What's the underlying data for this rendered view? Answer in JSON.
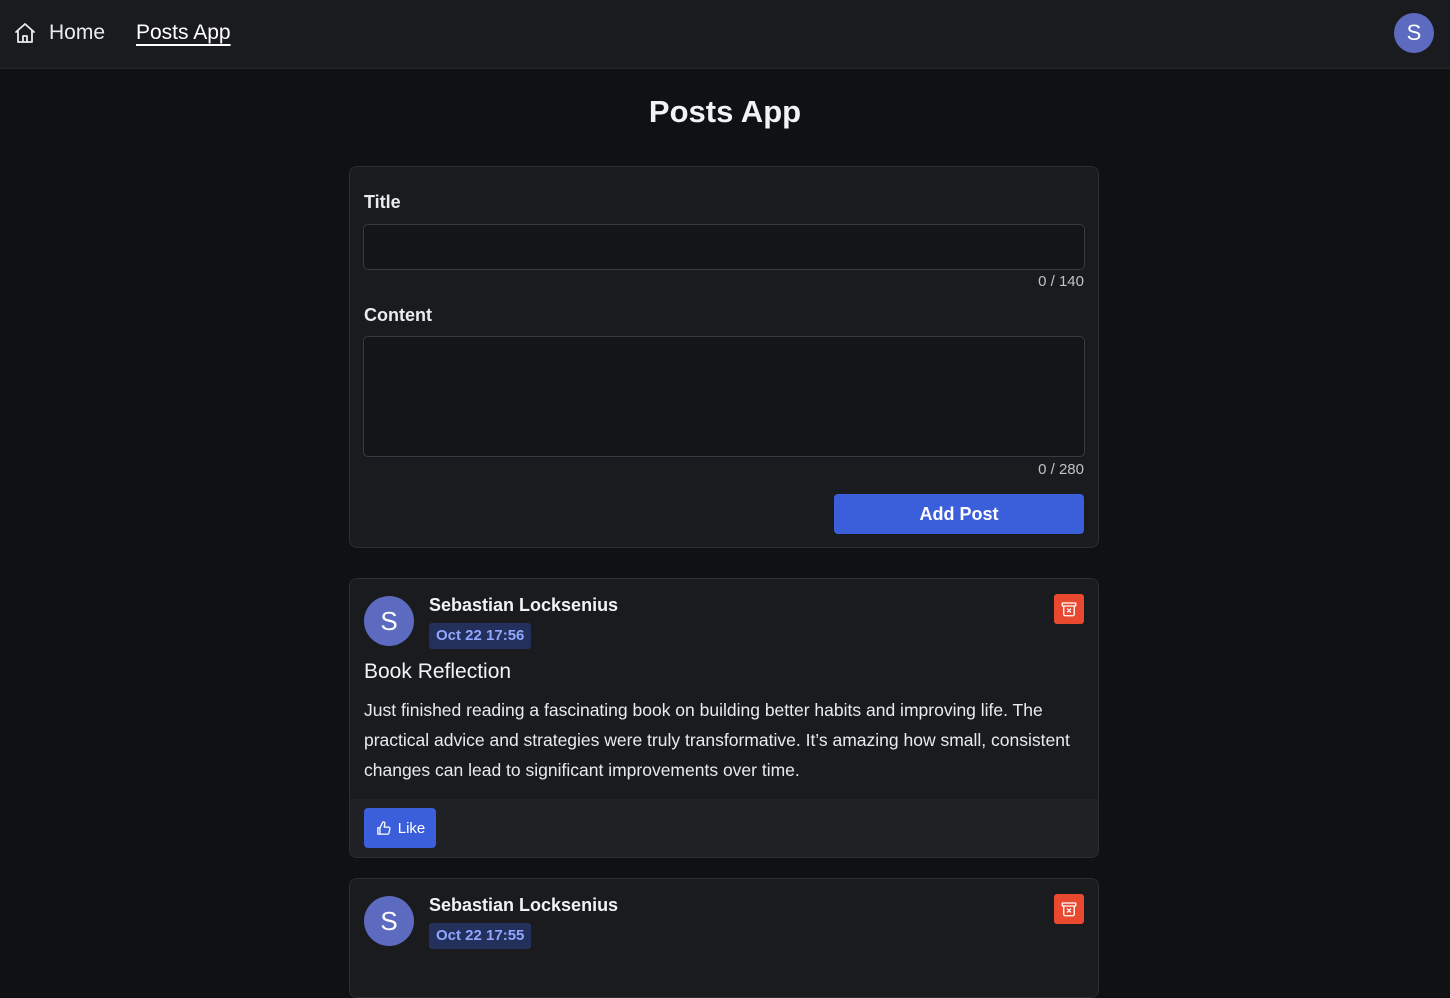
{
  "nav": {
    "home_label": "Home",
    "home_icon": "home-icon",
    "posts_label": "Posts App",
    "avatar_initial": "S"
  },
  "page_title": "Posts App",
  "form": {
    "title_label": "Title",
    "title_value": "",
    "title_counter": "0 / 140",
    "content_label": "Content",
    "content_value": "",
    "content_counter": "0 / 280",
    "submit_label": "Add Post"
  },
  "posts": [
    {
      "avatar_initial": "S",
      "author": "Sebastian Locksenius",
      "date": "Oct 22 17:56",
      "title": "Book Reflection",
      "body": "Just finished reading a fascinating book on building better habits and improving life. The practical advice and strategies were truly transformative. It’s amazing how small, consistent changes can lead to significant improvements over time.",
      "like_label": "Like",
      "delete_icon": "trash-icon",
      "like_icon": "thumb-up-icon"
    },
    {
      "avatar_initial": "S",
      "author": "Sebastian Locksenius",
      "date": "Oct 22 17:55",
      "delete_icon": "trash-icon"
    }
  ],
  "colors": {
    "background": "#101113",
    "navbar": "#1a1b1e",
    "accent_blue": "#3b5fdb",
    "avatar": "#5c6bc0",
    "delete_red": "#e8492f",
    "date_badge_bg": "#23305c",
    "date_badge_text": "#91a7ff"
  }
}
